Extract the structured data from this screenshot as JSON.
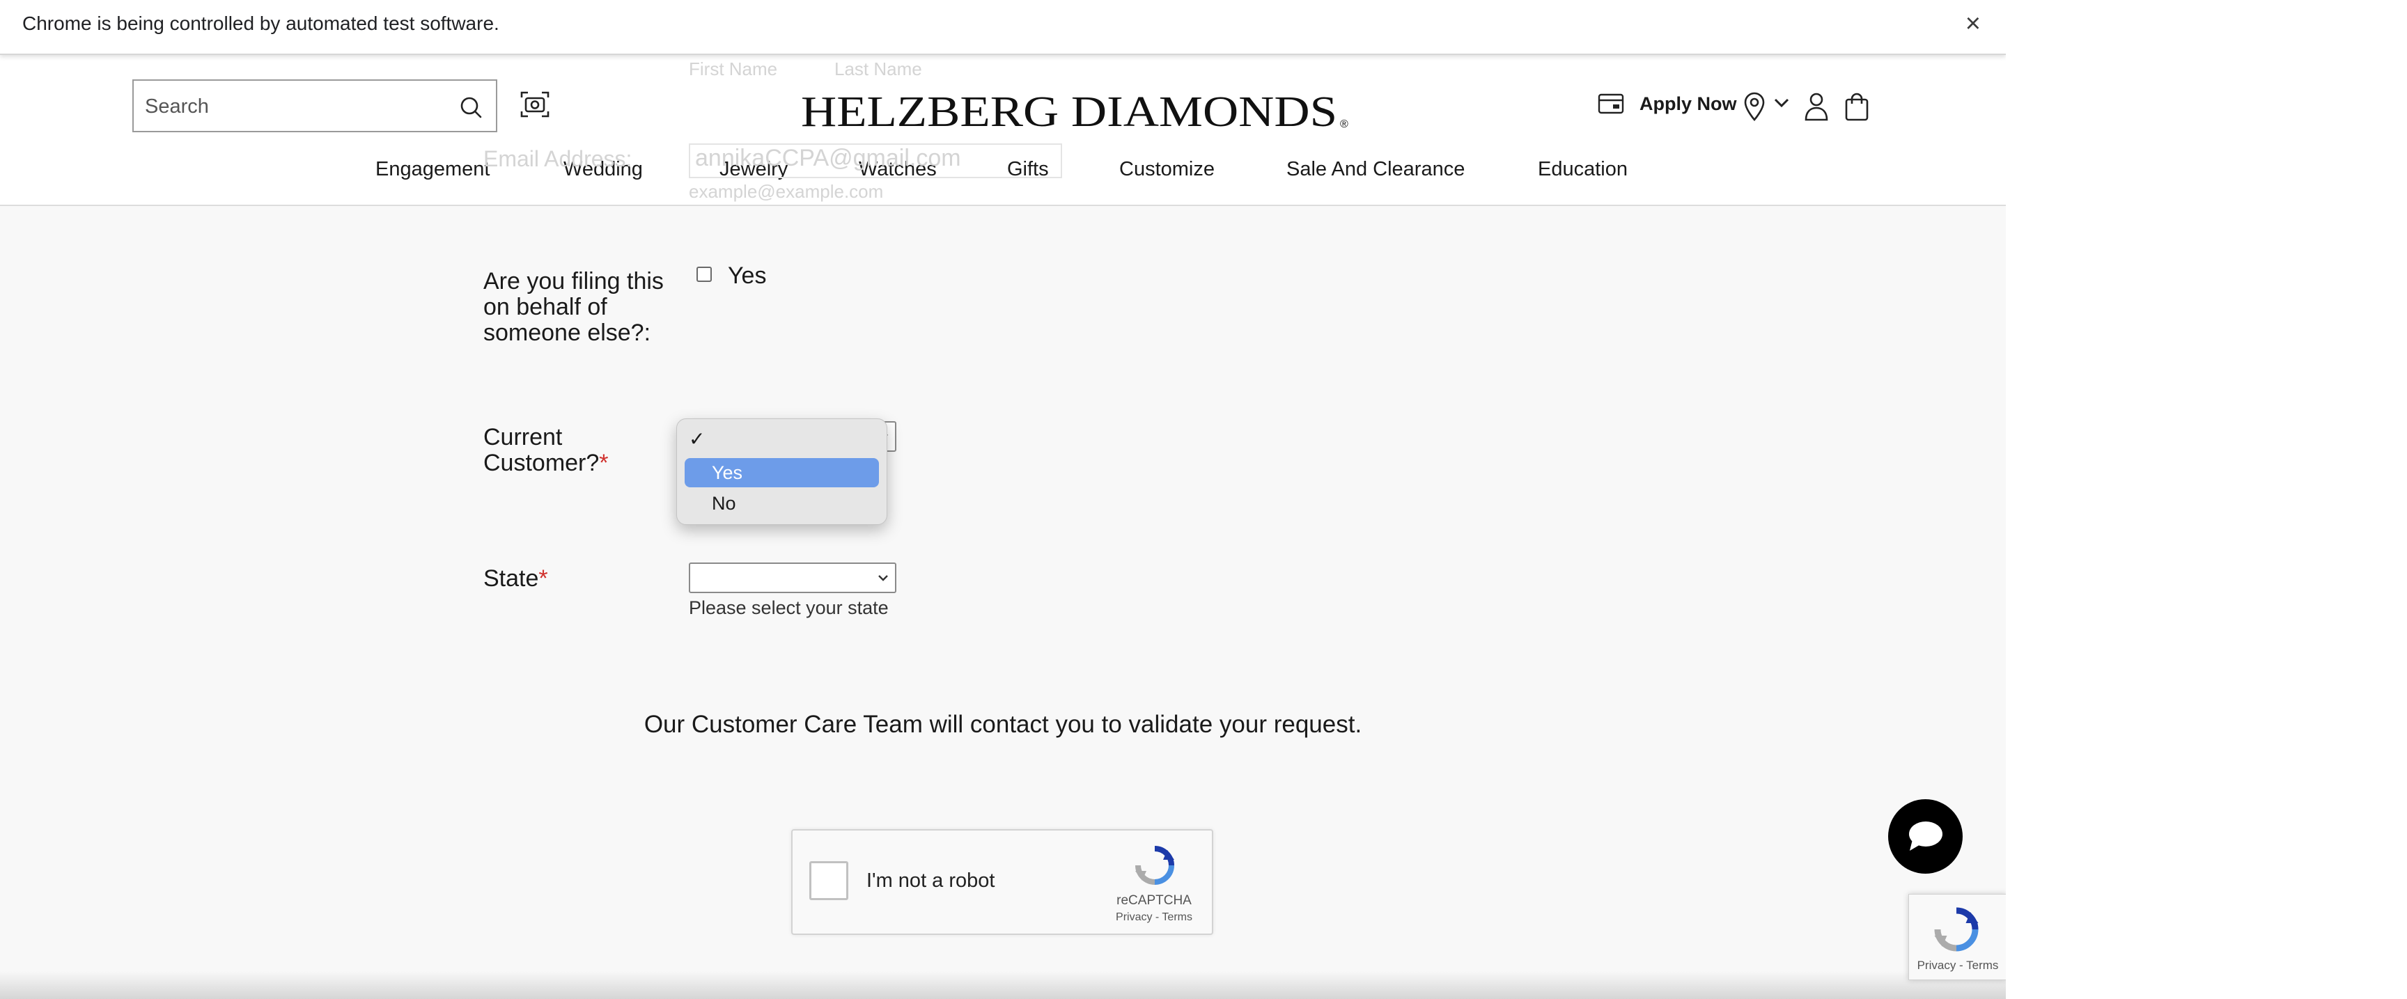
{
  "browser": {
    "infobar_text": "Chrome is being controlled by automated test software.",
    "infobar_close": "×"
  },
  "header": {
    "search_placeholder": "Search",
    "logo_text": "HELZBERG DIAMONDS",
    "logo_mark": "®",
    "apply_now": "Apply Now",
    "nav": [
      "Engagement",
      "Wedding",
      "Jewelry",
      "Watches",
      "Gifts",
      "Customize",
      "Sale And Clearance",
      "Education"
    ]
  },
  "ghost_form": {
    "first_name": "First Name",
    "last_name": "Last Name",
    "email_label": "Email Address:",
    "email_value": "annikaCCPA@gmail.com",
    "email_hint": "example@example.com"
  },
  "form": {
    "behalf_question": "Are you filing this on behalf of someone else?:",
    "behalf_option": "Yes",
    "customer_question": "Current Customer?",
    "required_mark": "*",
    "customer_dropdown": {
      "check_mark": "✓",
      "options": [
        "Yes",
        "No"
      ],
      "highlighted": "Yes"
    },
    "state_label": "State",
    "state_helper": "Please select your state",
    "care_message": "Our Customer Care Team will contact you to validate your request."
  },
  "recaptcha": {
    "label": "I'm not a robot",
    "brand": "reCAPTCHA",
    "terms": "Privacy - Terms"
  },
  "badge": {
    "terms": "Privacy - Terms"
  },
  "colors": {
    "required": "#d0312d",
    "dropdown_highlight": "#6d9ce9",
    "chat_button": "#000000"
  }
}
